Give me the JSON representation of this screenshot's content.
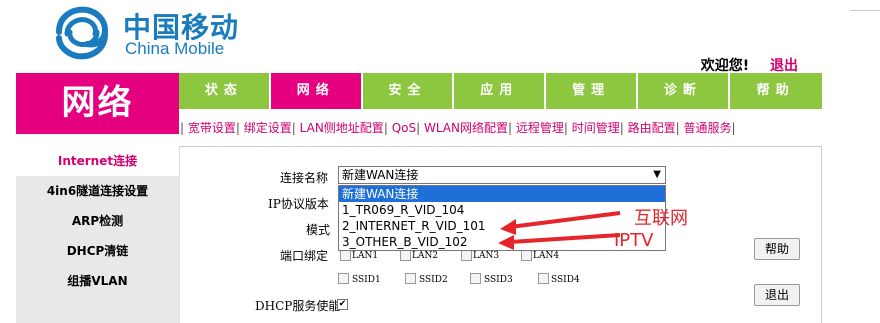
{
  "brand": {
    "name_cn": "中国移动",
    "name_en": "China Mobile"
  },
  "header": {
    "welcome": "欢迎您!",
    "logout": "退出"
  },
  "section_title": "网络",
  "nav_tabs": [
    "状态",
    "网络",
    "安全",
    "应用",
    "管理",
    "诊断",
    "帮助"
  ],
  "subnav": [
    "宽带设置",
    "绑定设置",
    "LAN侧地址配置",
    "QoS",
    "WLAN网络配置",
    "远程管理",
    "时间管理",
    "路由配置",
    "普通服务"
  ],
  "sidebar": [
    "Internet连接",
    "4in6隧道连接设置",
    "ARP检测",
    "DHCP清链",
    "组播VLAN"
  ],
  "form": {
    "connection_name_label": "连接名称",
    "connection_selected": "新建WAN连接",
    "ip_version_label": "IP协议版本",
    "mode_label": "模式",
    "port_binding_label": "端口绑定",
    "dhcp_label": "DHCP服务使能",
    "dhcp_checked": "✔",
    "options": [
      "新建WAN连接",
      "1_TR069_R_VID_104",
      "2_INTERNET_R_VID_101",
      "3_OTHER_B_VID_102"
    ],
    "ports_row1": [
      "LAN1",
      "LAN2",
      "LAN3",
      "LAN4"
    ],
    "ports_row2": [
      "SSID1",
      "SSID2",
      "SSID3",
      "SSID4"
    ]
  },
  "buttons": {
    "help": "帮助",
    "exit": "退出"
  },
  "annotations": {
    "internet": "互联网",
    "iptv": "IPTV"
  },
  "colors": {
    "brand_blue": "#1a7bbf",
    "magenta": "#e4007f",
    "green": "#8dc63f",
    "arrow_red": "#e5242b"
  }
}
